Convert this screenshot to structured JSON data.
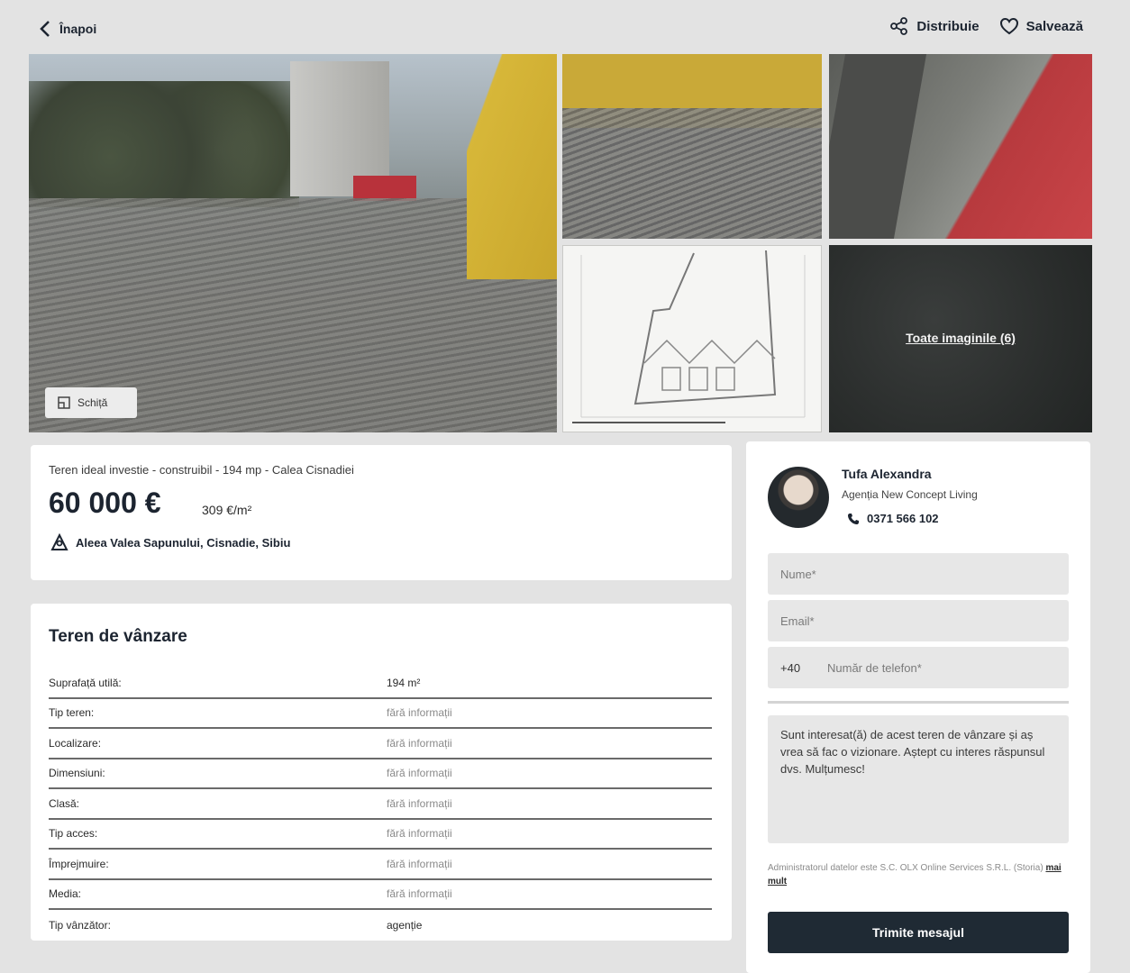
{
  "topbar": {
    "back_label": "Înapoi",
    "share_label": "Distribuie",
    "save_label": "Salvează"
  },
  "gallery": {
    "sketch_label": "Schiță",
    "all_images_label": "Toate imaginile (6)"
  },
  "listing": {
    "title": "Teren ideal investie - construibil - 194 mp - Calea Cisnadiei",
    "price": "60 000 €",
    "price_per_sqm": "309 €/m²",
    "address": "Aleea Valea Sapunului, Cisnadie, Sibiu"
  },
  "details": {
    "title": "Teren de vânzare",
    "rows": [
      {
        "label": "Suprafață utilă:",
        "value": "194 m²"
      },
      {
        "label": "Tip teren:",
        "value": "fără informații"
      },
      {
        "label": "Localizare:",
        "value": "fără informații"
      },
      {
        "label": "Dimensiuni:",
        "value": "fără informații"
      },
      {
        "label": "Clasă:",
        "value": "fără informații"
      },
      {
        "label": "Tip acces:",
        "value": "fără informații"
      },
      {
        "label": "Împrejmuire:",
        "value": "fără informații"
      },
      {
        "label": "Media:",
        "value": "fără informații"
      },
      {
        "label": "Tip vânzător:",
        "value": "agenție"
      }
    ]
  },
  "contact": {
    "agent_name": "Tufa Alexandra",
    "agency": "Agenția New Concept Living",
    "phone": "0371 566 102",
    "name_placeholder": "Nume*",
    "email_placeholder": "Email*",
    "phone_prefix": "+40",
    "phone_placeholder": "Număr de telefon*",
    "message": "Sunt interesat(ă) de acest teren de vânzare și aș vrea să fac o vizionare. Aștept cu interes răspunsul dvs. Mulțumesc!",
    "legal_text": "Administratorul datelor este S.C. OLX Online Services S.R.L. (Storia)",
    "legal_more": "mai mult",
    "submit_label": "Trimite mesajul"
  },
  "icons": [
    "chevron-left-icon",
    "share-icon",
    "heart-icon",
    "sketch-icon",
    "location-pin-icon",
    "phone-icon"
  ]
}
